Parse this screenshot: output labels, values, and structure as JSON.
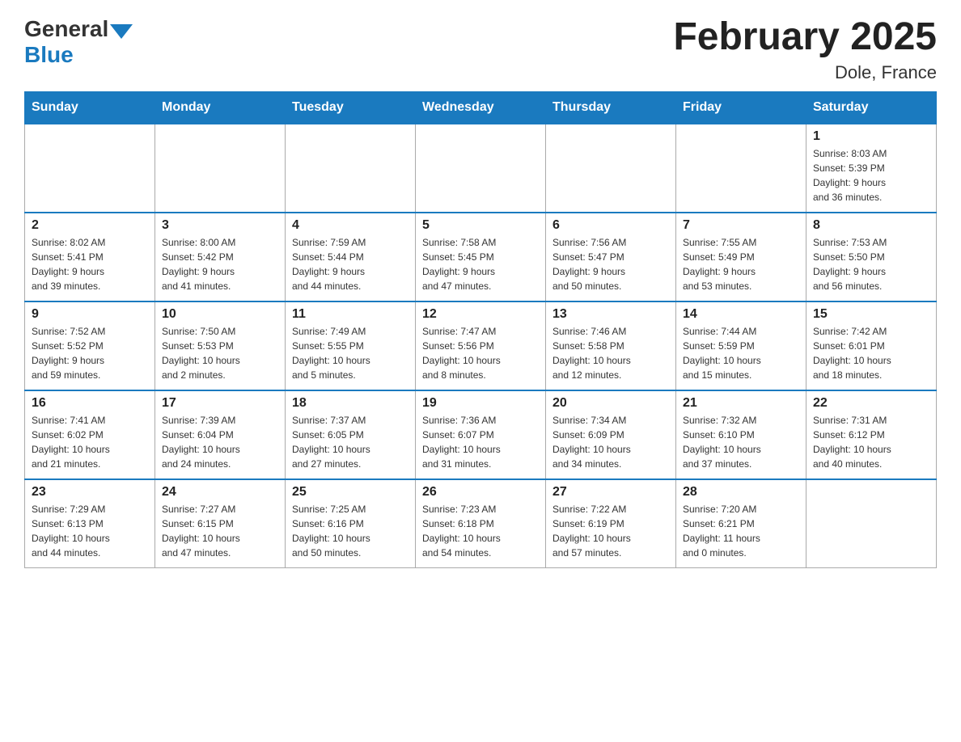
{
  "header": {
    "logo_general": "General",
    "logo_blue": "Blue",
    "title": "February 2025",
    "location": "Dole, France"
  },
  "days_of_week": [
    "Sunday",
    "Monday",
    "Tuesday",
    "Wednesday",
    "Thursday",
    "Friday",
    "Saturday"
  ],
  "weeks": [
    {
      "days": [
        {
          "number": "",
          "info": ""
        },
        {
          "number": "",
          "info": ""
        },
        {
          "number": "",
          "info": ""
        },
        {
          "number": "",
          "info": ""
        },
        {
          "number": "",
          "info": ""
        },
        {
          "number": "",
          "info": ""
        },
        {
          "number": "1",
          "info": "Sunrise: 8:03 AM\nSunset: 5:39 PM\nDaylight: 9 hours\nand 36 minutes."
        }
      ]
    },
    {
      "days": [
        {
          "number": "2",
          "info": "Sunrise: 8:02 AM\nSunset: 5:41 PM\nDaylight: 9 hours\nand 39 minutes."
        },
        {
          "number": "3",
          "info": "Sunrise: 8:00 AM\nSunset: 5:42 PM\nDaylight: 9 hours\nand 41 minutes."
        },
        {
          "number": "4",
          "info": "Sunrise: 7:59 AM\nSunset: 5:44 PM\nDaylight: 9 hours\nand 44 minutes."
        },
        {
          "number": "5",
          "info": "Sunrise: 7:58 AM\nSunset: 5:45 PM\nDaylight: 9 hours\nand 47 minutes."
        },
        {
          "number": "6",
          "info": "Sunrise: 7:56 AM\nSunset: 5:47 PM\nDaylight: 9 hours\nand 50 minutes."
        },
        {
          "number": "7",
          "info": "Sunrise: 7:55 AM\nSunset: 5:49 PM\nDaylight: 9 hours\nand 53 minutes."
        },
        {
          "number": "8",
          "info": "Sunrise: 7:53 AM\nSunset: 5:50 PM\nDaylight: 9 hours\nand 56 minutes."
        }
      ]
    },
    {
      "days": [
        {
          "number": "9",
          "info": "Sunrise: 7:52 AM\nSunset: 5:52 PM\nDaylight: 9 hours\nand 59 minutes."
        },
        {
          "number": "10",
          "info": "Sunrise: 7:50 AM\nSunset: 5:53 PM\nDaylight: 10 hours\nand 2 minutes."
        },
        {
          "number": "11",
          "info": "Sunrise: 7:49 AM\nSunset: 5:55 PM\nDaylight: 10 hours\nand 5 minutes."
        },
        {
          "number": "12",
          "info": "Sunrise: 7:47 AM\nSunset: 5:56 PM\nDaylight: 10 hours\nand 8 minutes."
        },
        {
          "number": "13",
          "info": "Sunrise: 7:46 AM\nSunset: 5:58 PM\nDaylight: 10 hours\nand 12 minutes."
        },
        {
          "number": "14",
          "info": "Sunrise: 7:44 AM\nSunset: 5:59 PM\nDaylight: 10 hours\nand 15 minutes."
        },
        {
          "number": "15",
          "info": "Sunrise: 7:42 AM\nSunset: 6:01 PM\nDaylight: 10 hours\nand 18 minutes."
        }
      ]
    },
    {
      "days": [
        {
          "number": "16",
          "info": "Sunrise: 7:41 AM\nSunset: 6:02 PM\nDaylight: 10 hours\nand 21 minutes."
        },
        {
          "number": "17",
          "info": "Sunrise: 7:39 AM\nSunset: 6:04 PM\nDaylight: 10 hours\nand 24 minutes."
        },
        {
          "number": "18",
          "info": "Sunrise: 7:37 AM\nSunset: 6:05 PM\nDaylight: 10 hours\nand 27 minutes."
        },
        {
          "number": "19",
          "info": "Sunrise: 7:36 AM\nSunset: 6:07 PM\nDaylight: 10 hours\nand 31 minutes."
        },
        {
          "number": "20",
          "info": "Sunrise: 7:34 AM\nSunset: 6:09 PM\nDaylight: 10 hours\nand 34 minutes."
        },
        {
          "number": "21",
          "info": "Sunrise: 7:32 AM\nSunset: 6:10 PM\nDaylight: 10 hours\nand 37 minutes."
        },
        {
          "number": "22",
          "info": "Sunrise: 7:31 AM\nSunset: 6:12 PM\nDaylight: 10 hours\nand 40 minutes."
        }
      ]
    },
    {
      "days": [
        {
          "number": "23",
          "info": "Sunrise: 7:29 AM\nSunset: 6:13 PM\nDaylight: 10 hours\nand 44 minutes."
        },
        {
          "number": "24",
          "info": "Sunrise: 7:27 AM\nSunset: 6:15 PM\nDaylight: 10 hours\nand 47 minutes."
        },
        {
          "number": "25",
          "info": "Sunrise: 7:25 AM\nSunset: 6:16 PM\nDaylight: 10 hours\nand 50 minutes."
        },
        {
          "number": "26",
          "info": "Sunrise: 7:23 AM\nSunset: 6:18 PM\nDaylight: 10 hours\nand 54 minutes."
        },
        {
          "number": "27",
          "info": "Sunrise: 7:22 AM\nSunset: 6:19 PM\nDaylight: 10 hours\nand 57 minutes."
        },
        {
          "number": "28",
          "info": "Sunrise: 7:20 AM\nSunset: 6:21 PM\nDaylight: 11 hours\nand 0 minutes."
        },
        {
          "number": "",
          "info": ""
        }
      ]
    }
  ]
}
